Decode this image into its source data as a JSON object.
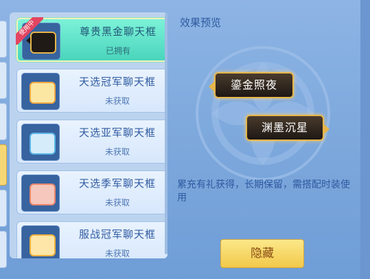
{
  "list": {
    "items": [
      {
        "name": "尊贵黑金聊天框",
        "status": "已拥有",
        "badge": "使用中",
        "selected": true,
        "bubble_color": "#1f1a15",
        "border_color": "#e7b54a"
      },
      {
        "name": "天选冠军聊天框",
        "status": "未获取",
        "badge": "",
        "selected": false,
        "bubble_color": "#fbe7a2",
        "border_color": "#f2a642"
      },
      {
        "name": "天选亚军聊天框",
        "status": "未获取",
        "badge": "",
        "selected": false,
        "bubble_color": "#d5ecfb",
        "border_color": "#5ab6e6"
      },
      {
        "name": "天选季军聊天框",
        "status": "未获取",
        "badge": "",
        "selected": false,
        "bubble_color": "#f6c7bc",
        "border_color": "#e9866d"
      },
      {
        "name": "服战冠军聊天框",
        "status": "未获取",
        "badge": "",
        "selected": false,
        "bubble_color": "#fde6a8",
        "border_color": "#f0b23f"
      }
    ]
  },
  "preview": {
    "title": "效果预览",
    "bubble1": "鎏金照夜",
    "bubble2": "渊墨沉星",
    "description": "累充有礼获得，长期保留，需搭配时装使用"
  },
  "actions": {
    "hide_label": "隐藏"
  },
  "colors": {
    "accent": "#f2c94a",
    "selected": "#49d5bc",
    "text": "#2f5aa0"
  }
}
